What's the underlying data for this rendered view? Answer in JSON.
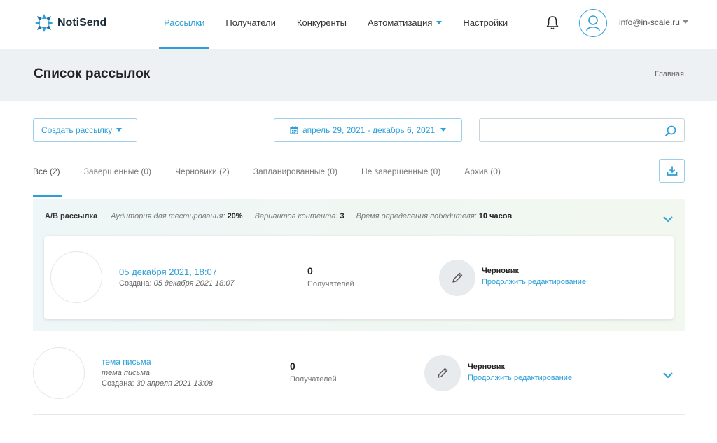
{
  "header": {
    "logo_text": "NotiSend",
    "nav": [
      {
        "label": "Рассылки",
        "active": true
      },
      {
        "label": "Получатели",
        "active": false
      },
      {
        "label": "Конкуренты",
        "active": false
      },
      {
        "label": "Автоматизация",
        "active": false,
        "dropdown": true
      },
      {
        "label": "Настройки",
        "active": false
      }
    ],
    "notification_icon": "bell-icon",
    "avatar_icon": "user-avatar-icon",
    "user_email": "info@in-scale.ru"
  },
  "page": {
    "title": "Список рассылок",
    "breadcrumb": "Главная"
  },
  "toolbar": {
    "create_label": "Создать рассылку",
    "date_range": "апрель 29, 2021 - декабрь 6, 2021",
    "search_value": "",
    "search_placeholder": ""
  },
  "tabs": [
    {
      "label": "Все (2)",
      "active": true
    },
    {
      "label": "Завершенные (0)",
      "active": false
    },
    {
      "label": "Черновики (2)",
      "active": false
    },
    {
      "label": "Запланированные (0)",
      "active": false
    },
    {
      "label": "Не завершенные (0)",
      "active": false
    },
    {
      "label": "Архив (0)",
      "active": false
    }
  ],
  "ab_test": {
    "title": "A/B рассылка",
    "audience_label": "Аудитория для тестирования:",
    "audience_value": "20%",
    "variants_label": "Вариантов контента:",
    "variants_value": "3",
    "winner_label": "Время определения победителя:",
    "winner_value": "10 часов",
    "mailing": {
      "date": "05 декабря 2021, 18:07",
      "created_label": "Создана:",
      "created_value": "05 декабря 2021 18:07",
      "recipients_count": "0",
      "recipients_label": "Получателей",
      "status": "Черновик",
      "action": "Продолжить редактирование"
    }
  },
  "mailings": [
    {
      "subject": "тема письма",
      "subtitle": "тема письма",
      "created_label": "Создана:",
      "created_value": "30 апреля 2021 13:08",
      "recipients_count": "0",
      "recipients_label": "Получателей",
      "status": "Черновик",
      "action": "Продолжить редактирование"
    }
  ],
  "colors": {
    "accent": "#2a9fd8",
    "title_bar_bg": "#eef1f3",
    "ab_block_bg": "#f0f7f2"
  }
}
